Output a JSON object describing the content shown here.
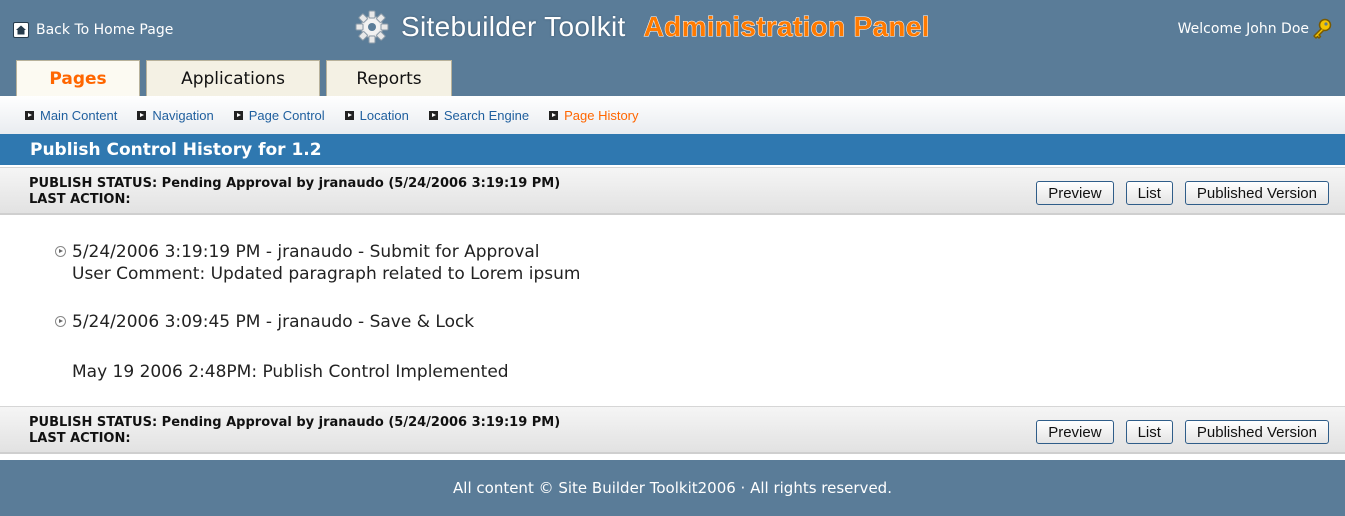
{
  "header": {
    "home_link": "Back To Home Page",
    "brand_title": "Sitebuilder Toolkit",
    "brand_subtitle": "Administration Panel",
    "welcome": "Welcome John Doe"
  },
  "tabs": [
    {
      "label": "Pages",
      "active": true
    },
    {
      "label": "Applications",
      "active": false
    },
    {
      "label": "Reports",
      "active": false
    }
  ],
  "subnav": [
    {
      "label": "Main Content",
      "active": false
    },
    {
      "label": "Navigation",
      "active": false
    },
    {
      "label": "Page Control",
      "active": false
    },
    {
      "label": "Location",
      "active": false
    },
    {
      "label": "Search Engine",
      "active": false
    },
    {
      "label": "Page History",
      "active": true
    }
  ],
  "page_title": "Publish Control History for 1.2",
  "status": {
    "publish_status": "PUBLISH STATUS: Pending Approval by jranaudo (5/24/2006 3:19:19 PM)",
    "last_action": "LAST ACTION:",
    "buttons": {
      "preview": "Preview",
      "list": "List",
      "published_version": "Published Version"
    }
  },
  "history": [
    {
      "line": "5/24/2006 3:19:19 PM - jranaudo - Submit for Approval",
      "comment": "User Comment: Updated paragraph related to Lorem ipsum"
    },
    {
      "line": "5/24/2006 3:09:45 PM - jranaudo - Save & Lock"
    }
  ],
  "implemented_note": "May 19 2006 2:48PM: Publish Control Implemented",
  "footer": "All content © Site Builder Toolkit2006 · All rights reserved.",
  "colors": {
    "header": "#5a7c98",
    "title_bar": "#2f78b0",
    "accent": "#ff6600",
    "link": "#1f5f9e"
  },
  "icons": [
    "home-icon",
    "gear-icon",
    "key-icon",
    "bullet-icon",
    "expand-icon"
  ]
}
